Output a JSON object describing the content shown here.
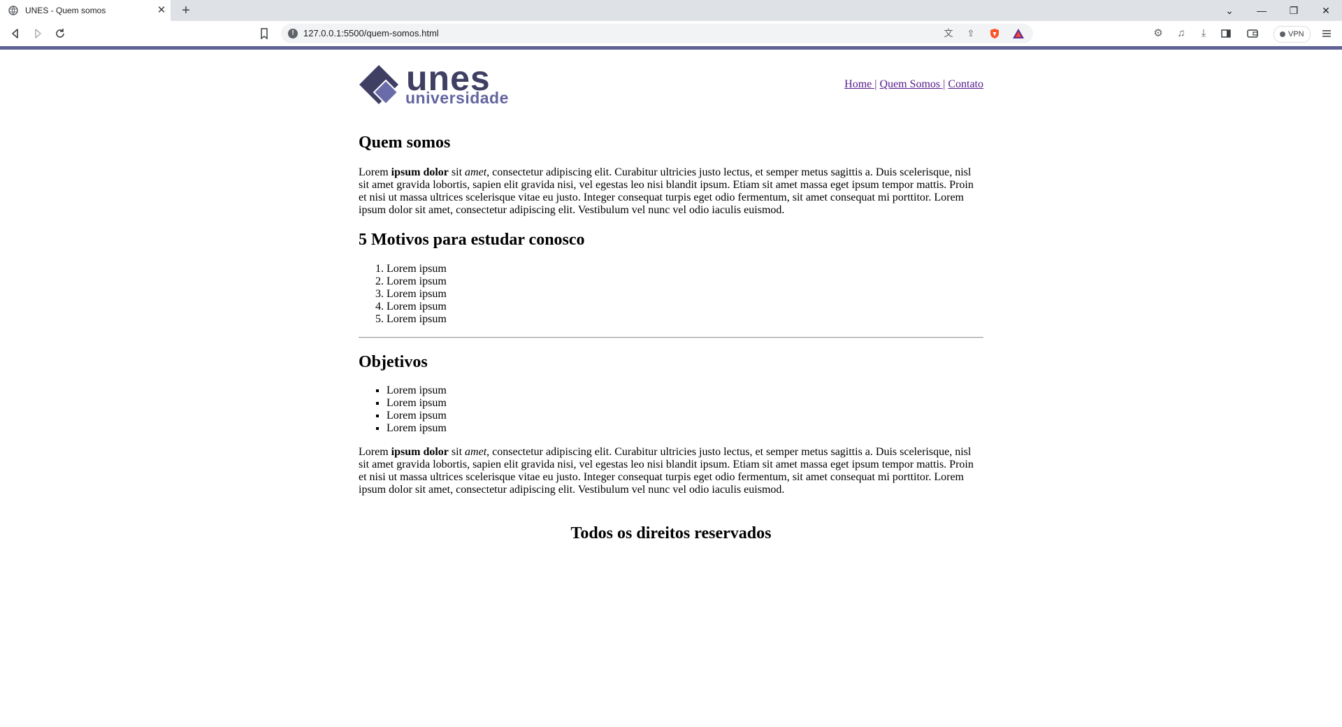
{
  "browser": {
    "tab_title": "UNES - Quem somos",
    "tab_close": "✕",
    "new_tab": "+",
    "url": "127.0.0.1:5500/quem-somos.html",
    "vpn_label": "VPN",
    "controls": {
      "dropdown": "⌄",
      "minimize": "—",
      "restore": "❐",
      "close": "✕"
    }
  },
  "logo": {
    "main": "unes",
    "sub": "universidade",
    "colors": {
      "dark": "#3e3f63",
      "light": "#6365a0"
    }
  },
  "nav": [
    {
      "label": "Home"
    },
    {
      "label": "Quem Somos"
    },
    {
      "label": "Contato"
    }
  ],
  "sections": {
    "quem_somos_title": "Quem somos",
    "paragraph": {
      "p1": "Lorem ",
      "bold": "ipsum dolor",
      "p2": " sit ",
      "italic": "amet",
      "p3": ", consectetur adipiscing elit. Curabitur ultricies justo lectus, et semper metus sagittis a. Duis scelerisque, nisl sit amet gravida lobortis, sapien elit gravida nisi, vel egestas leo nisi blandit ipsum. Etiam sit amet massa eget ipsum tempor mattis. Proin et nisi ut massa ultrices scelerisque vitae eu justo. Integer consequat turpis eget odio fermentum, sit amet consequat mi porttitor. Lorem ipsum dolor sit amet, consectetur adipiscing elit. Vestibulum vel nunc vel odio iaculis euismod."
    },
    "motivos_title": "5 Motivos para estudar conosco",
    "motivos": [
      "Lorem ipsum",
      "Lorem ipsum",
      "Lorem ipsum",
      "Lorem ipsum",
      "Lorem ipsum"
    ],
    "objetivos_title": "Objetivos",
    "objetivos": [
      "Lorem ipsum",
      "Lorem ipsum",
      "Lorem ipsum",
      "Lorem ipsum"
    ],
    "footer": "Todos os direitos reservados"
  },
  "colors": {
    "accent_bar": "#5f6294",
    "link": "#551a8b"
  }
}
